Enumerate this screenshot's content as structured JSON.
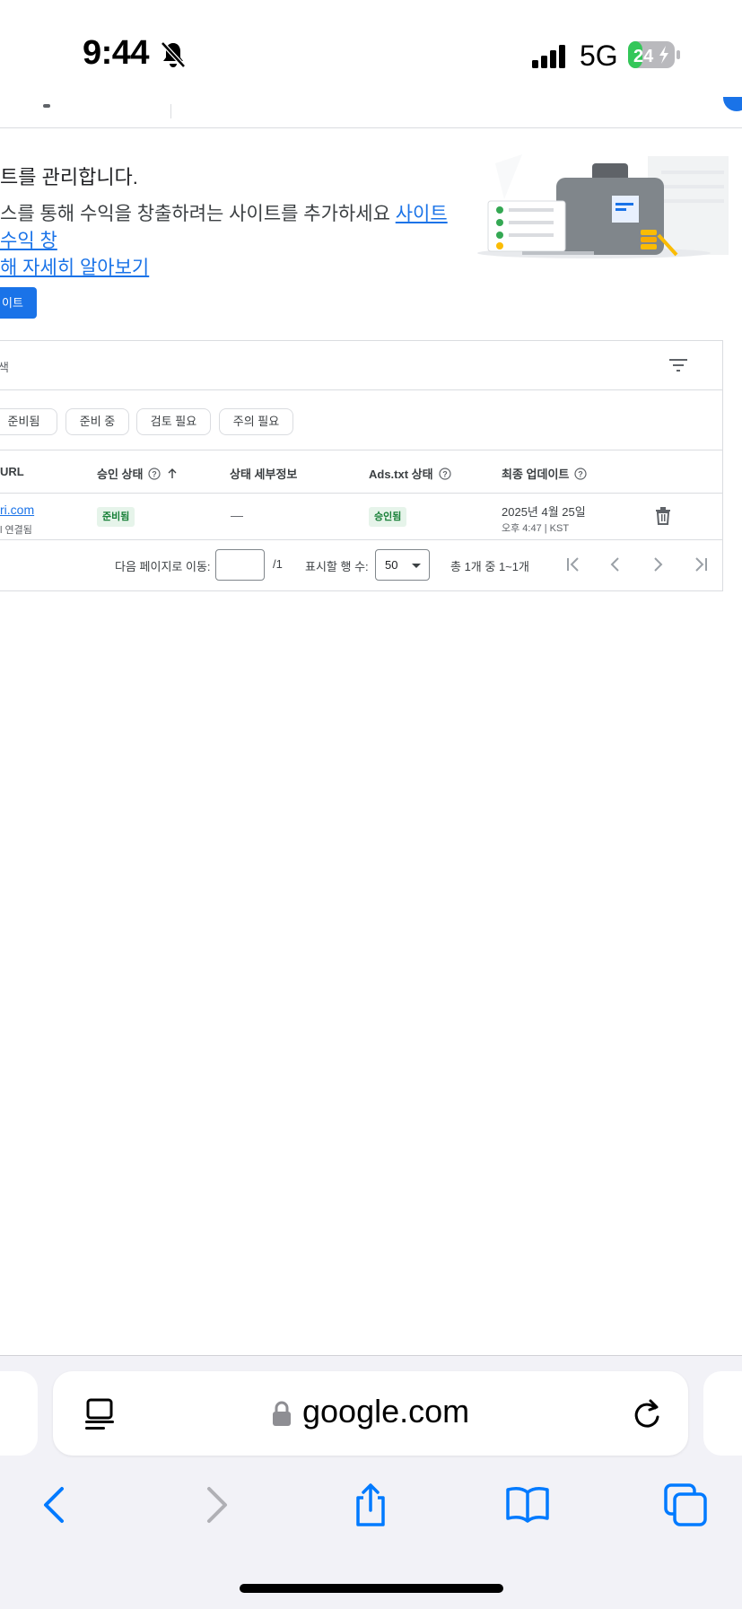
{
  "status_bar": {
    "time": "9:44",
    "network": "5G",
    "battery": "24"
  },
  "intro": {
    "title": "트를 관리합니다.",
    "text": "스를 통해 수익을 창출하려는 사이트를 추가하세요 ",
    "link1": "사이트 수익 창",
    "link2": "해 자세히 알아보기"
  },
  "new_site_button": "이트",
  "search": {
    "placeholder": "색"
  },
  "chips": [
    "준비됨",
    "준비 중",
    "검토 필요",
    "주의 필요"
  ],
  "table": {
    "headers": {
      "url": "URL",
      "approval": "승인 상태",
      "details": "상태 세부정보",
      "adstxt": "Ads.txt 상태",
      "updated": "최종 업데이트"
    },
    "row": {
      "url": "ri.com",
      "url_sub": "l 연결됨",
      "approval": "준비됨",
      "details": "—",
      "adstxt": "승인됨",
      "date": "2025년 4월 25일",
      "time": "오후 4:47 | KST"
    }
  },
  "pager": {
    "goto_label": "다음 페이지로 이동:",
    "page_total": "/1",
    "rows_label": "표시할 행 수:",
    "rows_value": "50",
    "range": "총 1개 중 1~1개"
  },
  "browser": {
    "url": "google.com"
  },
  "colors": {
    "accent": "#1a73e8",
    "success_bg": "#e6f4ea",
    "success_text": "#188038"
  }
}
